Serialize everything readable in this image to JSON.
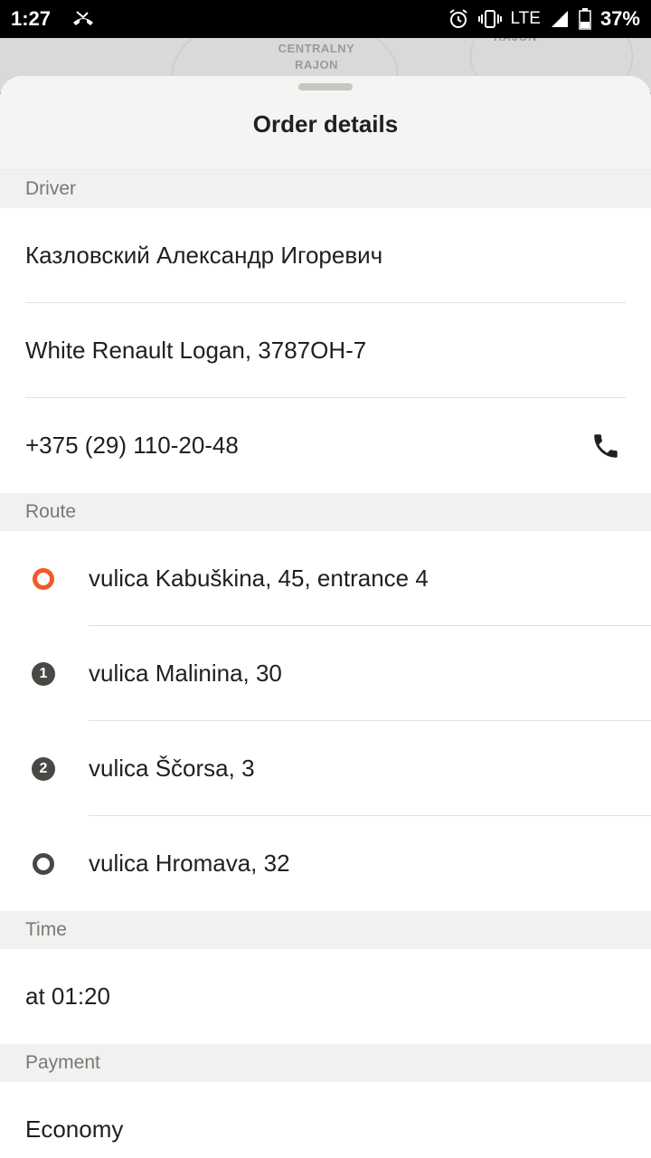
{
  "status_bar": {
    "time": "1:27",
    "network": "LTE",
    "battery": "37%",
    "icons": [
      "missed-call-icon",
      "alarm-icon",
      "vibrate-icon",
      "signal-icon",
      "battery-icon"
    ]
  },
  "map": {
    "district_label_1": "CENTRALNY",
    "district_label_2": "RAJON",
    "district_label_3": "RAJON"
  },
  "sheet": {
    "title": "Order details"
  },
  "driver": {
    "header": "Driver",
    "name": "Казловский Александр Игоревич",
    "car": "White Renault Logan, 3787ОН-7",
    "phone": "+375 (29) 110-20-48"
  },
  "route": {
    "header": "Route",
    "stops": [
      {
        "marker": "start",
        "address": "vulica Kabuškina, 45, entrance 4"
      },
      {
        "marker": "1",
        "address": "vulica Malinina, 30"
      },
      {
        "marker": "2",
        "address": "vulica Ščorsa, 3"
      },
      {
        "marker": "end",
        "address": "vulica Hromava, 32"
      }
    ]
  },
  "time": {
    "header": "Time",
    "value": "at 01:20"
  },
  "payment": {
    "header": "Payment",
    "value": "Economy"
  },
  "colors": {
    "accent": "#f05a28",
    "marker_dark": "#4a4845",
    "section_bg": "#f2f1ef",
    "header_bg": "#f5f4f2"
  }
}
